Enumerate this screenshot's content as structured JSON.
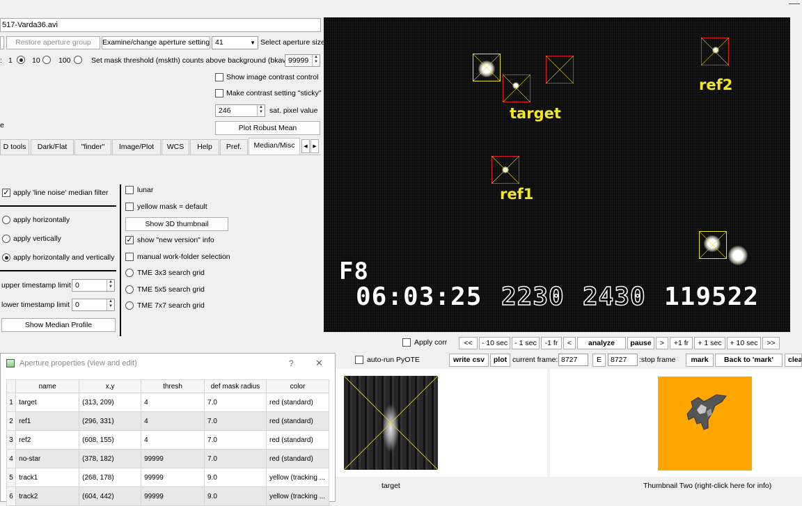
{
  "file": {
    "name": "517-Varda36.avi"
  },
  "top": {
    "restore_aperture_group": "Restore aperture group",
    "examine_change_aperture": "Examine/change aperture settings",
    "aperture_size_value": "41",
    "select_aperture_size": "Select aperture size",
    "mask_options": [
      "1",
      "10",
      "100"
    ],
    "mask_selected": "1",
    "mask_threshold_label": "Set mask threshold (mskth) counts above background (bkavg)",
    "mask_threshold_value": "99999",
    "show_contrast": "Show image contrast control",
    "sticky_contrast": "Make contrast setting \"sticky\"",
    "sat_value": "246",
    "sat_label": "sat. pixel value",
    "plot_robust_mean": "Plot Robust Mean",
    "left_fragment": "e"
  },
  "tabs": [
    "D tools",
    "Dark/Flat",
    "\"finder\"",
    "Image/Plot",
    "WCS",
    "Help",
    "Pref.",
    "Median/Misc"
  ],
  "active_tab": "Median/Misc",
  "median": {
    "apply_line_noise": "apply 'line noise' median filter",
    "apply_horizontally": "apply horizontally",
    "apply_vertically": "apply vertically",
    "apply_both": "apply horizontally and vertically",
    "upper_ts_label": "upper timestamp limit",
    "upper_ts_value": "0",
    "lower_ts_label": "lower timestamp limit",
    "lower_ts_value": "0",
    "show_median_profile": "Show Median Profile"
  },
  "misc": {
    "lunar": "lunar",
    "yellow_mask": "yellow mask = default",
    "show_3d": "Show 3D thumbnail",
    "new_version": "show \"new version\" info",
    "manual_folder": "manual work-folder selection",
    "tme3": "TME 3x3 search grid",
    "tme5": "TME 5x5 search grid",
    "tme7": "TME 7x7 search grid"
  },
  "video": {
    "labels": {
      "target": "target",
      "ref1": "ref1",
      "ref2": "ref2"
    },
    "vti_line1": "F8",
    "vti_time": "06:03:25",
    "vti_n1": "2230",
    "vti_n2": "2430",
    "vti_n3": "119522"
  },
  "controls": {
    "apply_corr": "Apply corr",
    "auto_run_pyote": "auto-run PyOTE",
    "nav": [
      "<<",
      "- 10 sec",
      "- 1 sec",
      "-1 fr",
      "<",
      "analyze",
      "pause",
      ">",
      "+1 fr",
      "+ 1 sec",
      "+ 10 sec",
      ">>"
    ],
    "write_csv": "write csv",
    "plot": "plot",
    "current_frame_label": "current frame:",
    "current_frame_value": "8727",
    "e_label": "E",
    "stop_frame_value": "8727",
    "stop_frame_label": ":stop frame",
    "mark": "mark",
    "back_to_mark": "Back to 'mark'",
    "clear_fragment": "clea"
  },
  "thumbs": {
    "thumb1_caption": "target",
    "thumb2_caption": "Thumbnail Two (right-click here for info)"
  },
  "aperture_window": {
    "title": "Aperture properties (view and edit)",
    "help": "?",
    "close": "✕",
    "columns": [
      "name",
      "x,y",
      "thresh",
      "def mask radius",
      "color"
    ],
    "rows": [
      [
        "1",
        "target",
        "(313, 209)",
        "4",
        "7.0",
        "red (standard)"
      ],
      [
        "2",
        "ref1",
        "(296, 331)",
        "4",
        "7.0",
        "red (standard)"
      ],
      [
        "3",
        "ref2",
        "(608, 155)",
        "4",
        "7.0",
        "red (standard)"
      ],
      [
        "4",
        "no-star",
        "(378, 182)",
        "99999",
        "7.0",
        "red (standard)"
      ],
      [
        "5",
        "track1",
        "(268, 178)",
        "99999",
        "9.0",
        "yellow (tracking ..."
      ],
      [
        "6",
        "track2",
        "(604, 442)",
        "99999",
        "9.0",
        "yellow (tracking ..."
      ]
    ]
  },
  "colors": {
    "aperture_red": "#e02020",
    "aperture_yellow": "#e8e020",
    "label_yellow": "#f2e82a",
    "thumb_orange": "#ffa500"
  }
}
